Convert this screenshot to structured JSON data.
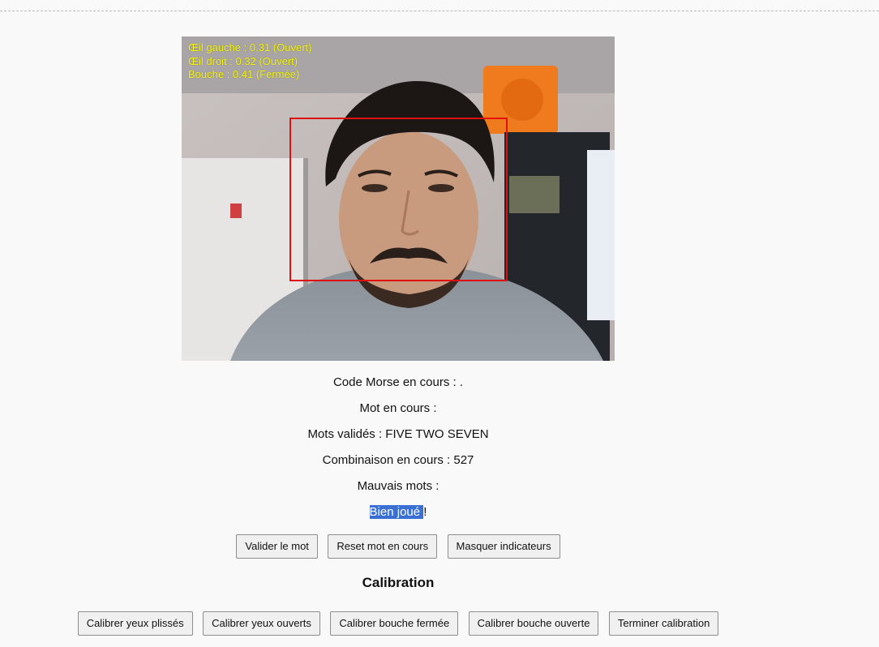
{
  "video": {
    "overlay": {
      "left_eye": "Œil gauche : 0.31 (Ouvert)",
      "right_eye": "Œil droit : 0.32 (Ouvert)",
      "mouth": "Bouche : 0.41 (Fermée)"
    },
    "overlay_color": "#f5f500",
    "face_box_color": "#e01010"
  },
  "status": {
    "morse_label": "Code Morse en cours : .",
    "current_word_label": "Mot en cours :",
    "validated_words_label": "Mots validés : FIVE TWO SEVEN",
    "combination_label": "Combinaison en cours : 527",
    "wrong_words_label": "Mauvais mots :",
    "message_selected": "Bien joué ",
    "message_rest": "!"
  },
  "actions": {
    "validate": "Valider le mot",
    "reset": "Reset mot en cours",
    "hide": "Masquer indicateurs"
  },
  "calibration": {
    "title": "Calibration",
    "squint": "Calibrer yeux plissés",
    "open_eyes": "Calibrer yeux ouverts",
    "mouth_closed": "Calibrer bouche fermée",
    "mouth_open": "Calibrer bouche ouverte",
    "finish": "Terminer calibration"
  },
  "colors": {
    "selection": "#3a6fd4"
  }
}
